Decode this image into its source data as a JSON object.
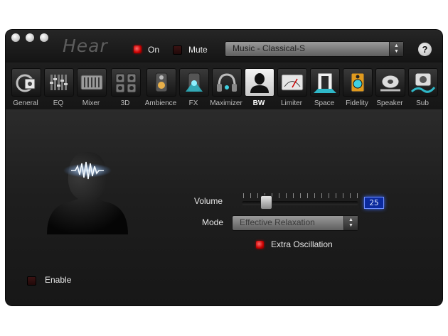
{
  "window": {
    "app_name": "Hear",
    "on_label": "On",
    "mute_label": "Mute",
    "preset": "Music - Classical-S",
    "help_label": "?"
  },
  "tabs": [
    {
      "label": "General",
      "icon": "general-icon"
    },
    {
      "label": "EQ",
      "icon": "eq-icon"
    },
    {
      "label": "Mixer",
      "icon": "mixer-icon"
    },
    {
      "label": "3D",
      "icon": "3d-speakers-icon"
    },
    {
      "label": "Ambience",
      "icon": "ambience-icon"
    },
    {
      "label": "FX",
      "icon": "fx-icon"
    },
    {
      "label": "Maximizer",
      "icon": "headphones-icon"
    },
    {
      "label": "BW",
      "icon": "brainwave-head-icon",
      "active": true
    },
    {
      "label": "Limiter",
      "icon": "limiter-meter-icon"
    },
    {
      "label": "Space",
      "icon": "space-door-icon"
    },
    {
      "label": "Fidelity",
      "icon": "fidelity-speaker-icon"
    },
    {
      "label": "Speaker",
      "icon": "speaker-record-icon"
    },
    {
      "label": "Sub",
      "icon": "subwoofer-icon"
    }
  ],
  "bw": {
    "volume_label": "Volume",
    "volume_value": "25",
    "mode_label": "Mode",
    "mode_value": "Effective Relaxation",
    "extra_oscillation_label": "Extra Oscillation",
    "extra_oscillation_on": true,
    "enable_label": "Enable",
    "enable_on": false
  },
  "colors": {
    "window_bg": "#1b1b1b",
    "led_on": "#d10000",
    "value_box": "#0b2a9e",
    "wave_glow": "#cfe6ff"
  }
}
